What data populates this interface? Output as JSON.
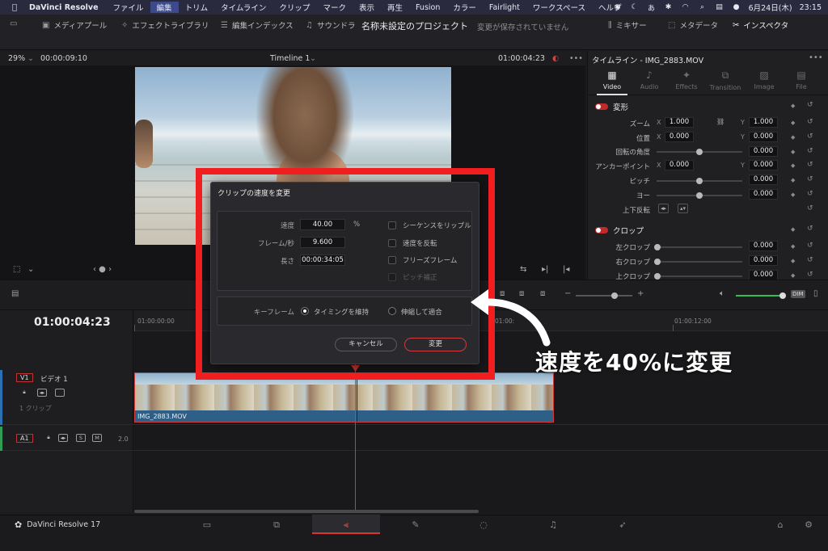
{
  "menubar": {
    "app_name": "DaVinci Resolve",
    "items": [
      "ファイル",
      "編集",
      "トリム",
      "タイムライン",
      "クリップ",
      "マーク",
      "表示",
      "再生",
      "Fusion",
      "カラー",
      "Fairlight",
      "ワークスペース",
      "ヘルプ"
    ],
    "active_index": 1,
    "date": "6月24日(木)",
    "time": "23:15",
    "input_method": "あ"
  },
  "toolbar": {
    "media_pool": "メディアプール",
    "effects_library": "エフェクトライブラリ",
    "edit_index": "編集インデックス",
    "sound_library": "サウンドラ",
    "project_title": "名称未設定のプロジェクト",
    "save_status": "変更が保存されていません",
    "mixer": "ミキサー",
    "metadata": "メタデータ",
    "inspector": "インスペクタ"
  },
  "viewer": {
    "zoom": "29%",
    "source_timecode": "00:00:09:10",
    "timeline_name": "Timeline 1",
    "record_timecode": "01:00:04:23"
  },
  "inspector": {
    "title": "タイムライン - IMG_2883.MOV",
    "tabs": [
      {
        "label": "Video",
        "icon": "film-icon"
      },
      {
        "label": "Audio",
        "icon": "music-icon"
      },
      {
        "label": "Effects",
        "icon": "wand-icon"
      },
      {
        "label": "Transition",
        "icon": "transition-icon"
      },
      {
        "label": "Image",
        "icon": "image-icon"
      },
      {
        "label": "File",
        "icon": "file-icon"
      }
    ],
    "active_tab": 0,
    "transform": {
      "title": "変形",
      "zoom_label": "ズーム",
      "zoom_x": "1.000",
      "zoom_y": "1.000",
      "position_label": "位置",
      "position_x": "0.000",
      "position_y": "0.000",
      "rotation_label": "回転の角度",
      "rotation": "0.000",
      "anchor_label": "アンカーポイント",
      "anchor_x": "0.000",
      "anchor_y": "0.000",
      "pitch_label": "ピッチ",
      "pitch": "0.000",
      "yaw_label": "ヨー",
      "yaw": "0.000",
      "flip_label": "上下反転"
    },
    "crop": {
      "title": "クロップ",
      "left_label": "左クロップ",
      "left": "0.000",
      "right_label": "右クロップ",
      "right": "0.000",
      "top_label": "上クロップ",
      "top": "0.000"
    }
  },
  "timeline": {
    "timecode": "01:00:04:23",
    "ruler": [
      "01:00:00:00",
      "01:00:",
      "01:00:12:00"
    ],
    "video_track": {
      "tag": "V1",
      "name": "ビデオ 1",
      "clip_count": "1 クリップ"
    },
    "audio_track": {
      "tag": "A1",
      "level": "2.0",
      "solo": "S",
      "mute": "M"
    },
    "clip_name": "IMG_2883.MOV",
    "dim_label": "DIM"
  },
  "dialog": {
    "title": "クリップの速度を変更",
    "speed_label": "速度",
    "speed_value": "40.00",
    "speed_unit": "%",
    "fps_label": "フレーム/秒",
    "fps_value": "9.600",
    "duration_label": "長さ",
    "duration_value": "00:00:34:05",
    "ripple_sequence": "シーケンスをリップル",
    "reverse_speed": "速度を反転",
    "freeze_frame": "フリーズフレーム",
    "pitch_correction": "ピッチ補正",
    "keyframes_label": "キーフレーム",
    "keep_timing": "タイミングを維持",
    "stretch_to_fit": "伸縮して適合",
    "cancel": "キャンセル",
    "ok": "変更"
  },
  "pagebar": {
    "brand": "DaVinci Resolve 17"
  },
  "annotation": {
    "text": "速度を40%に変更",
    "frame_color": "#f01e1e"
  }
}
